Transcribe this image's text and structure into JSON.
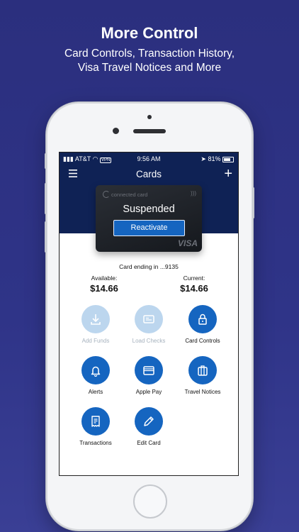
{
  "headline": "More Control",
  "subline_1": "Card Controls, Transaction History,",
  "subline_2": "Visa Travel Notices and More",
  "status_bar": {
    "carrier": "AT&T",
    "vpn": "VPN",
    "time": "9:56 AM",
    "battery": "81%"
  },
  "nav": {
    "title": "Cards"
  },
  "card": {
    "brand": "connected card",
    "status": "Suspended",
    "reactivate_label": "Reactivate",
    "network": "VISA",
    "ending_text": "Card ending in ...9135"
  },
  "balances": {
    "available_label": "Available:",
    "available_value": "$14.66",
    "current_label": "Current:",
    "current_value": "$14.66"
  },
  "actions": [
    {
      "label": "Add Funds",
      "icon": "download-icon",
      "enabled": false
    },
    {
      "label": "Load Checks",
      "icon": "check-icon",
      "enabled": false
    },
    {
      "label": "Card Controls",
      "icon": "lock-icon",
      "enabled": true
    },
    {
      "label": "Alerts",
      "icon": "bell-icon",
      "enabled": true
    },
    {
      "label": "Apple Pay",
      "icon": "wallet-icon",
      "enabled": true
    },
    {
      "label": "Travel Notices",
      "icon": "suitcase-icon",
      "enabled": true
    },
    {
      "label": "Transactions",
      "icon": "receipt-icon",
      "enabled": true
    },
    {
      "label": "Edit Card",
      "icon": "pencil-icon",
      "enabled": true
    }
  ],
  "colors": {
    "primary": "#1565c0",
    "header": "#0f2255",
    "disabled": "#bcd6ee",
    "background": "#2b2f7e"
  }
}
